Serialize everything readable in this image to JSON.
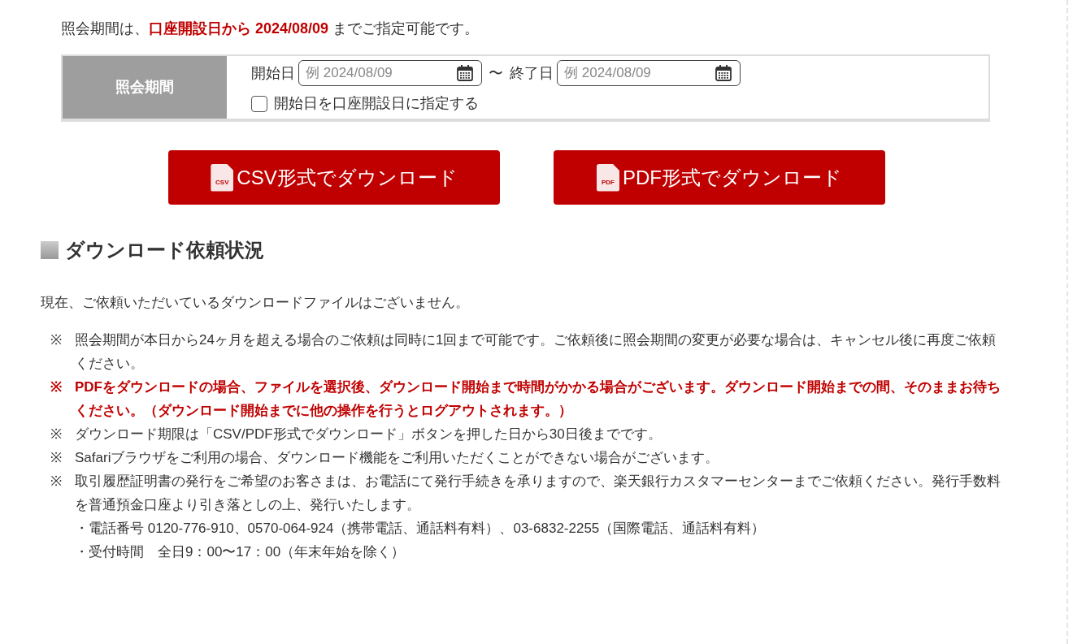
{
  "period_notice": [
    {
      "text": "照会期間は、",
      "highlight": false
    },
    {
      "text": "口座開設日から 2024/08/09",
      "highlight": true
    },
    {
      "text": " までご指定可能です。",
      "highlight": false
    }
  ],
  "period_form": {
    "label": "照会期間",
    "start_label": "開始日",
    "start_placeholder": "例 2024/08/09",
    "separator": "〜",
    "end_label": "終了日",
    "end_placeholder": "例 2024/08/09",
    "checkbox": {
      "label": "開始日を口座開設日に指定する",
      "checked": false
    }
  },
  "buttons": [
    {
      "label": "CSV形式でダウンロード",
      "icon_text": "CSV"
    },
    {
      "label": "PDF形式でダウンロード",
      "icon_text": "PDF"
    }
  ],
  "section": {
    "title": "ダウンロード依頼状況",
    "status": "現在、ご依頼いただいているダウンロードファイルはございません。"
  },
  "notes": [
    {
      "mark": "※",
      "text": "照会期間が本日から24ヶ月を超える場合のご依頼は同時に1回まで可能です。ご依頼後に照会期間の変更が必要な場合は、キャンセル後に再度ご依頼ください。",
      "kind": "normal"
    },
    {
      "mark": "※",
      "text": "PDFをダウンロードの場合、ファイルを選択後、ダウンロード開始まで時間がかかる場合がございます。ダウンロード開始までの間、そのままお待ちください。（ダウンロード開始までに他の操作を行うとログアウトされます。）",
      "kind": "alert"
    },
    {
      "mark": "※",
      "text": "ダウンロード期限は「CSV/PDF形式でダウンロード」ボタンを押した日から30日後までです。",
      "kind": "normal"
    },
    {
      "mark": "※",
      "text": "Safariブラウザをご利用の場合、ダウンロード機能をご利用いただくことができない場合がございます。",
      "kind": "normal"
    },
    {
      "mark": "※",
      "text": "取引履歴証明書の発行をご希望のお客さまは、お電話にて発行手続きを承りますので、楽天銀行カスタマーセンターまでご依頼ください。発行手数料を普通預金口座より引き落としの上、発行いたします。",
      "kind": "normal",
      "children": [
        {
          "text": "・電話番号 0120-776-910、0570-064-924（携帯電話、通話料有料）、03-6832-2255（国際電話、通話料有料）"
        },
        {
          "text": "・受付時間　全日9：00〜17：00（年末年始を除く）"
        }
      ]
    }
  ]
}
